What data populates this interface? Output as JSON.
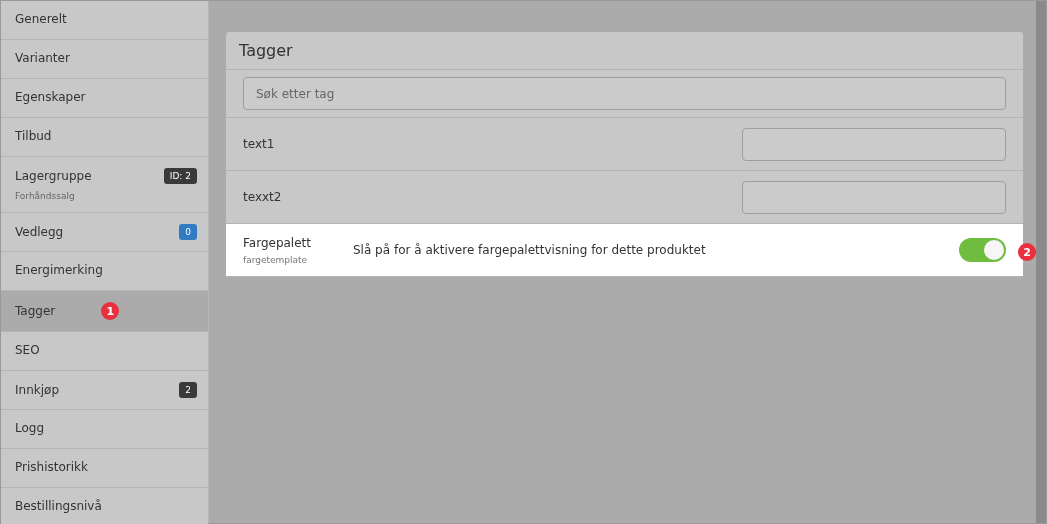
{
  "sidebar": {
    "items": [
      {
        "label": "Generelt",
        "selected": false
      },
      {
        "label": "Varianter",
        "selected": false
      },
      {
        "label": "Egenskaper",
        "selected": false
      },
      {
        "label": "Tilbud",
        "selected": false
      },
      {
        "label": "Lagergruppe",
        "sublabel": "Forhåndssalg",
        "badge": {
          "text": "ID: 2",
          "color": "#3a3a3a"
        },
        "selected": false
      },
      {
        "label": "Vedlegg",
        "badge": {
          "text": "0",
          "color": "#2f7bc4"
        },
        "selected": false
      },
      {
        "label": "Energimerking",
        "selected": false
      },
      {
        "label": "Tagger",
        "selected": true,
        "marker": "1"
      },
      {
        "label": "SEO",
        "selected": false
      },
      {
        "label": "Innkjøp",
        "badge": {
          "text": "2",
          "color": "#3a3a3a"
        },
        "selected": false
      },
      {
        "label": "Logg",
        "selected": false
      },
      {
        "label": "Prishistorikk",
        "selected": false
      },
      {
        "label": "Bestillingsnivå",
        "selected": false
      }
    ]
  },
  "panel": {
    "title": "Tagger",
    "search": {
      "placeholder": "Søk etter tag"
    },
    "rows": [
      {
        "kind": "text",
        "label": "text1"
      },
      {
        "kind": "text",
        "label": "texxt2"
      },
      {
        "kind": "toggle",
        "label": "Fargepalett",
        "sublabel": "fargetemplate",
        "description": "Slå på for å aktivere fargepalettvisning for dette produktet",
        "on": true,
        "marker": "2"
      }
    ]
  }
}
